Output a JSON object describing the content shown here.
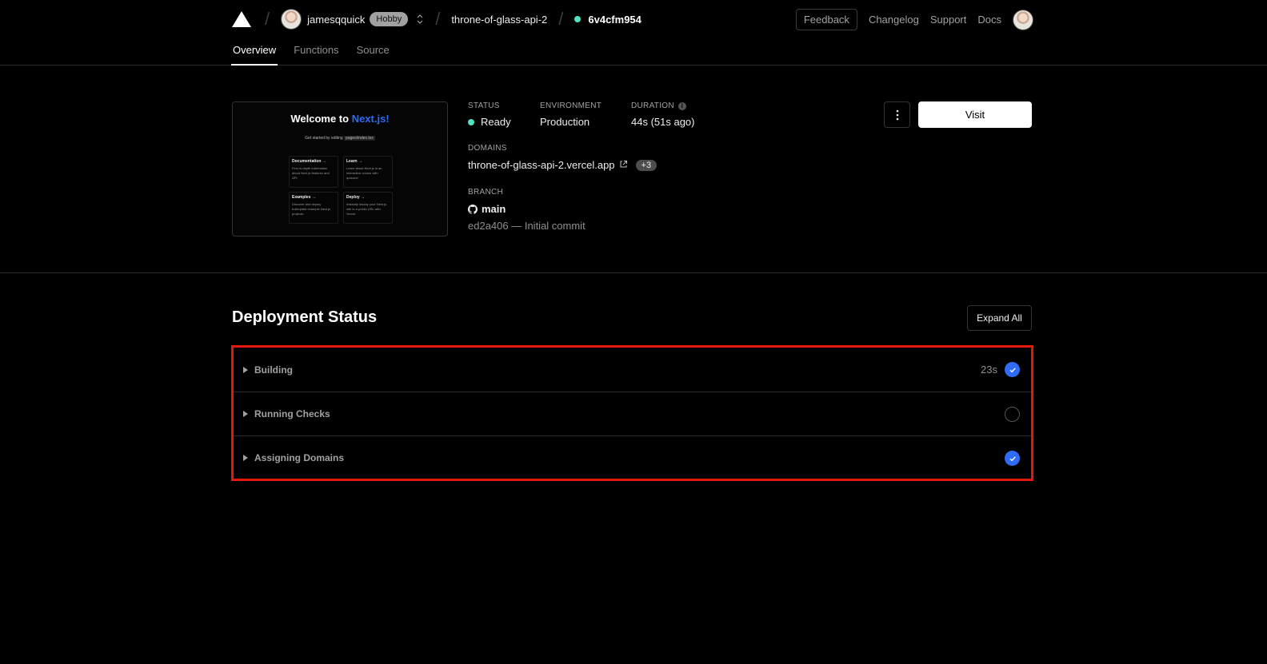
{
  "header": {
    "username": "jamesqquick",
    "plan_badge": "Hobby",
    "project": "throne-of-glass-api-2",
    "deployment_id": "6v4cfm954",
    "deployment_dot_color": "#50e3c2",
    "feedback_label": "Feedback",
    "nav": [
      "Changelog",
      "Support",
      "Docs"
    ]
  },
  "tabs": [
    "Overview",
    "Functions",
    "Source"
  ],
  "preview": {
    "title_prefix": "Welcome to ",
    "title_accent": "Next.js!",
    "subtitle_prefix": "Get started by editing",
    "subtitle_code": "pages/index.tsx",
    "cards": [
      {
        "heading": "Documentation →",
        "text": "Find in-depth information about Next.js features and API."
      },
      {
        "heading": "Learn →",
        "text": "Learn about Next.js in an interactive course with quizzes!"
      },
      {
        "heading": "Examples →",
        "text": "Discover and deploy boilerplate example Next.js projects."
      },
      {
        "heading": "Deploy →",
        "text": "Instantly deploy your Next.js site to a public URL with Vercel."
      }
    ]
  },
  "overview": {
    "status_label": "STATUS",
    "status_value": "Ready",
    "status_color": "#50e3c2",
    "environment_label": "ENVIRONMENT",
    "environment_value": "Production",
    "duration_label": "DURATION",
    "duration_value": "44s (51s ago)",
    "domains_label": "DOMAINS",
    "domain": "throne-of-glass-api-2.vercel.app",
    "domain_extra": "+3",
    "branch_label": "BRANCH",
    "branch": "main",
    "commit": "ed2a406 — Initial commit",
    "visit_label": "Visit"
  },
  "deployment_status": {
    "title": "Deployment Status",
    "expand_label": "Expand All",
    "steps": [
      {
        "label": "Building",
        "time": "23s",
        "state": "complete"
      },
      {
        "label": "Running Checks",
        "time": "",
        "state": "pending"
      },
      {
        "label": "Assigning Domains",
        "time": "",
        "state": "complete"
      }
    ]
  },
  "colors": {
    "accent_blue": "#2f6bf5",
    "highlight_border": "#e3170a"
  }
}
